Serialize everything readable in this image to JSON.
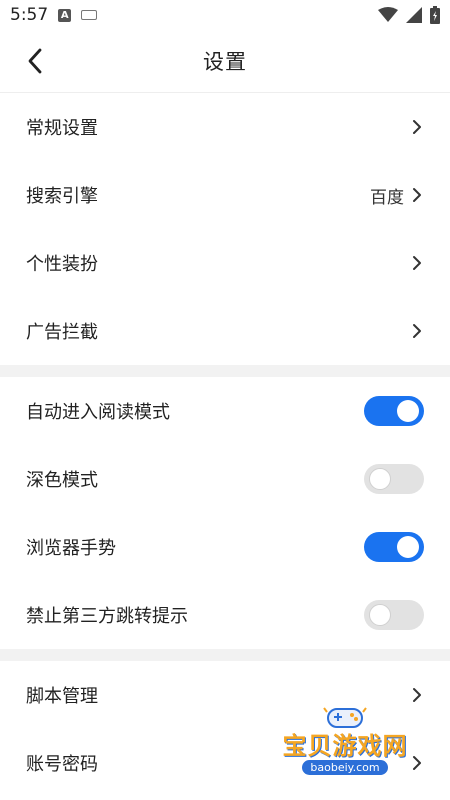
{
  "status_bar": {
    "time": "5:57",
    "notification_letter": "A"
  },
  "header": {
    "title": "设置"
  },
  "settings_nav": [
    {
      "label": "常规设置",
      "value": ""
    },
    {
      "label": "搜索引擎",
      "value": "百度"
    },
    {
      "label": "个性装扮",
      "value": ""
    },
    {
      "label": "广告拦截",
      "value": ""
    }
  ],
  "toggles": [
    {
      "label": "自动进入阅读模式",
      "on": true
    },
    {
      "label": "深色模式",
      "on": false
    },
    {
      "label": "浏览器手势",
      "on": true
    },
    {
      "label": "禁止第三方跳转提示",
      "on": false
    }
  ],
  "more_nav": [
    {
      "label": "脚本管理"
    },
    {
      "label": "账号密码"
    }
  ],
  "watermark": {
    "text": "宝贝游戏网",
    "url": "baobeiy.com"
  },
  "colors": {
    "accent": "#1a73f0",
    "toggle_off": "#e2e2e2",
    "divider": "#f2f2f2"
  }
}
